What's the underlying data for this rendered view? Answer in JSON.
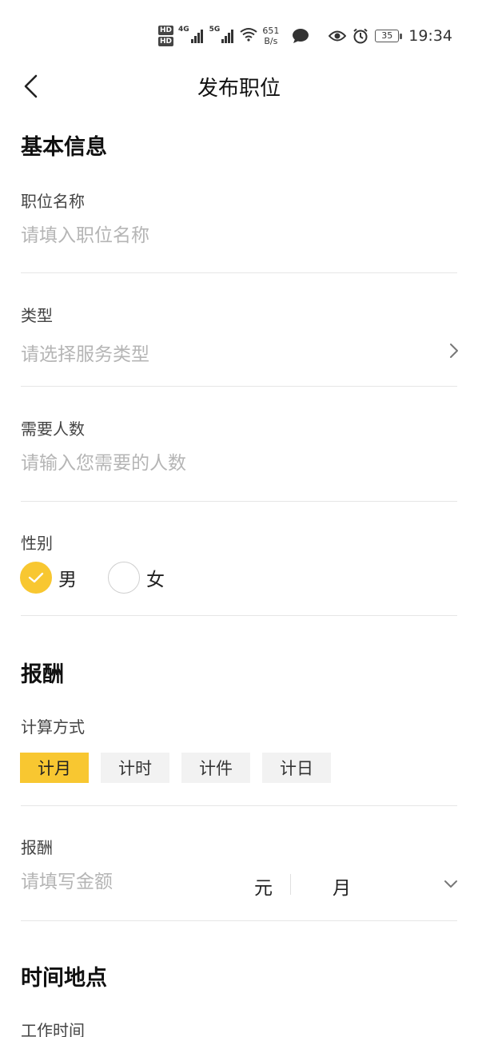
{
  "status_bar": {
    "hd_top": "HD",
    "hd_bottom": "HD",
    "net1": "4G",
    "net2": "5G",
    "speed_value": "651",
    "speed_unit": "B/s",
    "battery": "35",
    "time": "19:34"
  },
  "nav": {
    "title": "发布职位"
  },
  "basic": {
    "section_title": "基本信息",
    "job_name": {
      "label": "职位名称",
      "placeholder": "请填入职位名称"
    },
    "type": {
      "label": "类型",
      "placeholder": "请选择服务类型"
    },
    "headcount": {
      "label": "需要人数",
      "placeholder": "请输入您需要的人数"
    },
    "gender": {
      "label": "性别",
      "options": [
        {
          "label": "男",
          "checked": true
        },
        {
          "label": "女",
          "checked": false
        }
      ]
    }
  },
  "pay": {
    "section_title": "报酬",
    "method_label": "计算方式",
    "methods": [
      {
        "label": "计月",
        "active": true
      },
      {
        "label": "计时",
        "active": false
      },
      {
        "label": "计件",
        "active": false
      },
      {
        "label": "计日",
        "active": false
      }
    ],
    "amount_label": "报酬",
    "amount_placeholder": "请填写金额",
    "currency_unit": "元",
    "period_unit": "月"
  },
  "time_place": {
    "section_title": "时间地点",
    "work_time_label": "工作时间"
  },
  "colors": {
    "accent": "#f8c731",
    "placeholder": "#b5b5b5",
    "divider": "#e6e6e6",
    "chip_bg": "#f2f2f2"
  },
  "icons": [
    "back-arrow-icon",
    "chevron-right-icon",
    "chevron-down-icon",
    "check-icon",
    "wifi-icon",
    "message-icon",
    "eye-icon",
    "alarm-icon"
  ]
}
